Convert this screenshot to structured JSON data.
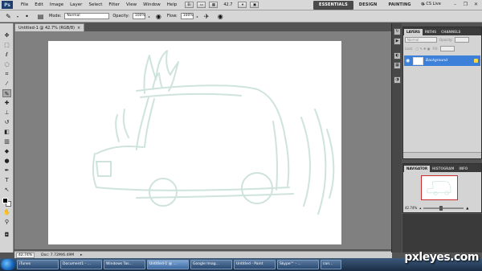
{
  "app": {
    "logo_text": "Ps",
    "menu": [
      "File",
      "Edit",
      "Image",
      "Layer",
      "Select",
      "Filter",
      "View",
      "Window",
      "Help"
    ],
    "zoom_display": "42.7",
    "workspaces": [
      "ESSENTIALS",
      "DESIGN",
      "PAINTING",
      "»"
    ],
    "cs_live": "CS Live"
  },
  "options": {
    "mode_label": "Mode:",
    "mode_value": "Normal",
    "opacity_label": "Opacity:",
    "opacity_value": "100%",
    "flow_label": "Flow:",
    "flow_value": "100%"
  },
  "document": {
    "tab_title": "Untitled-1 @ 42.7% (RGB/8)",
    "zoom": "42.74%",
    "doc_info": "Doc: 7.72M/6.49M",
    "sketch_color": "#cfe3dd"
  },
  "layers_panel": {
    "tabs": [
      "LAYERS",
      "PATHS",
      "CHANNELS"
    ],
    "blend_mode": "Normal",
    "opacity_label": "Opacity:",
    "lock_label": "Lock:",
    "fill_label": "Fill:",
    "layer_name": "Background"
  },
  "navigator_panel": {
    "tabs": [
      "NAVIGATOR",
      "HISTOGRAM",
      "INFO"
    ],
    "zoom": "42.74%"
  },
  "taskbar": {
    "items": [
      "iTunes",
      "Document1 - ...",
      "Windows Tas...",
      "Untitled-1 @ ...",
      "Google Imag...",
      "Untitled - Paint",
      "Skype™ - ...",
      "con..."
    ]
  },
  "watermark": "pxleyes.com"
}
